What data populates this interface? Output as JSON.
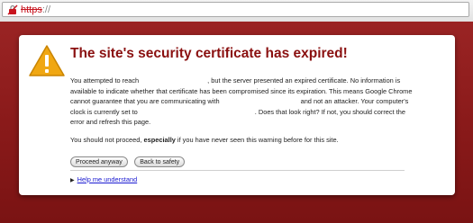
{
  "browser": {
    "url_scheme": "https",
    "url_rest": "://"
  },
  "colors": {
    "background": "#8e1b1b",
    "title": "#8a1010",
    "link": "#1a1ad1",
    "warning_icon": "#f0a712"
  },
  "interstitial": {
    "title": "The site's security certificate has expired!",
    "para1_a": "You attempted to reach",
    "para1_b": ", but the server presented an expired certificate. No information is available to indicate whether that certificate has been compromised since its expiration. This means Google Chrome cannot guarantee that you are communicating with",
    "para1_c": "and not an attacker. Your computer's clock is currently set to",
    "para1_d": ". Does that look right? If not, you should correct the error and refresh this page.",
    "para2_a": "You should not proceed,",
    "para2_bold": "especially",
    "para2_c": "if you have never seen this warning before for this site.",
    "proceed_label": "Proceed anyway",
    "back_label": "Back to safety",
    "help_label": "Help me understand"
  }
}
